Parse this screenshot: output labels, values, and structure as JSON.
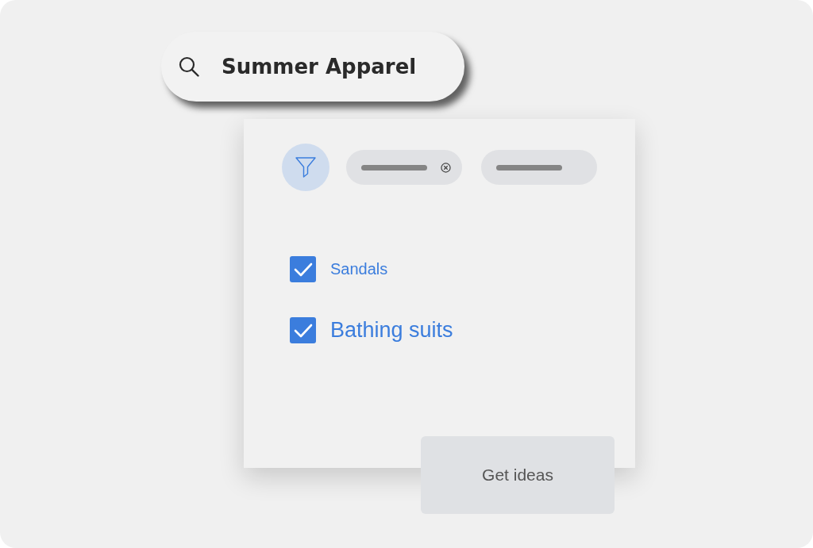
{
  "search": {
    "value": "Summer Apparel"
  },
  "filter_chips": [
    {
      "removable": true
    },
    {
      "removable": false
    }
  ],
  "options": [
    {
      "label": "Sandals",
      "checked": true
    },
    {
      "label": "Bathing suits",
      "checked": true
    }
  ],
  "button": {
    "label": "Get ideas"
  }
}
